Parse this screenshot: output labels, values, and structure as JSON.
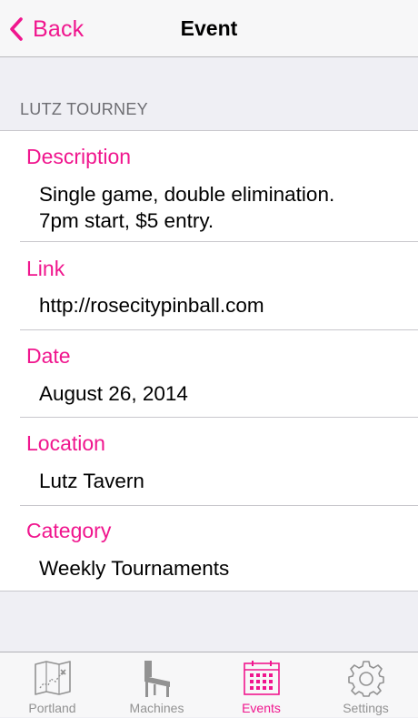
{
  "colors": {
    "accent": "#f0168e",
    "inactive": "#929292",
    "background": "#efeff4"
  },
  "navbar": {
    "back_label": "Back",
    "back_icon": "chevron-left-icon",
    "title": "Event"
  },
  "section": {
    "header": "LUTZ TOURNEY"
  },
  "details": [
    {
      "label": "Description",
      "value_lines": [
        "Single game, double elimination.",
        "7pm start, $5 entry."
      ]
    },
    {
      "label": "Link",
      "value_lines": [
        "http://rosecitypinball.com"
      ]
    },
    {
      "label": "Date",
      "value_lines": [
        "August 26, 2014"
      ]
    },
    {
      "label": "Location",
      "value_lines": [
        "Lutz Tavern"
      ]
    },
    {
      "label": "Category",
      "value_lines": [
        "Weekly Tournaments"
      ]
    }
  ],
  "tabbar": {
    "active": "events",
    "tabs": [
      {
        "label": "Portland",
        "icon": "map-icon"
      },
      {
        "label": "Machines",
        "icon": "pinball-machine-icon"
      },
      {
        "label": "Events",
        "icon": "calendar-icon"
      },
      {
        "label": "Settings",
        "icon": "gear-icon"
      }
    ]
  }
}
